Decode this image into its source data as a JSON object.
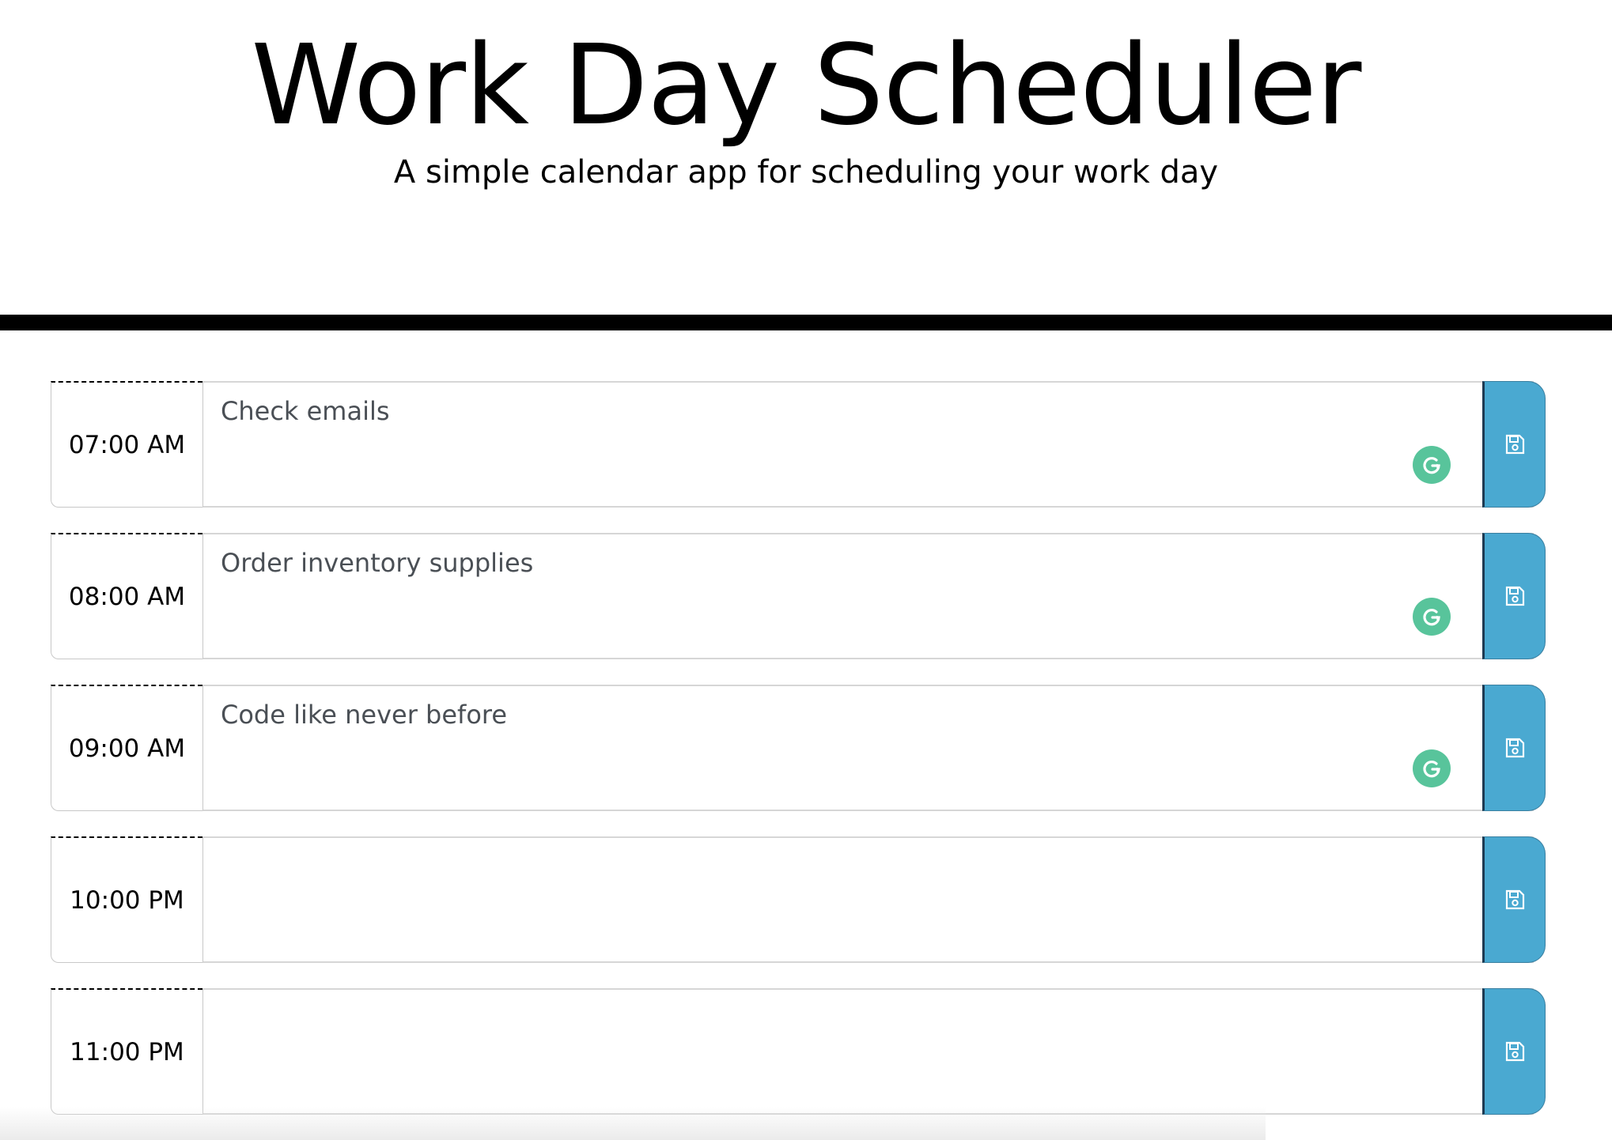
{
  "header": {
    "title": "Work Day Scheduler",
    "subtitle": "A simple calendar app for scheduling your work day"
  },
  "rows": [
    {
      "hour": "07:00 AM",
      "text": "Check emails",
      "has_grammarly": true
    },
    {
      "hour": "08:00 AM",
      "text": "Order inventory supplies",
      "has_grammarly": true
    },
    {
      "hour": "09:00 AM",
      "text": "Code like never before",
      "has_grammarly": true
    },
    {
      "hour": "10:00 PM",
      "text": "",
      "has_grammarly": false
    },
    {
      "hour": "11:00 PM",
      "text": "",
      "has_grammarly": false
    }
  ],
  "icons": {
    "save": "save-icon",
    "grammarly": "grammarly-icon"
  },
  "colors": {
    "save_button": "#4aa9d1",
    "grammarly": "#58c49b",
    "divider": "#000000"
  }
}
